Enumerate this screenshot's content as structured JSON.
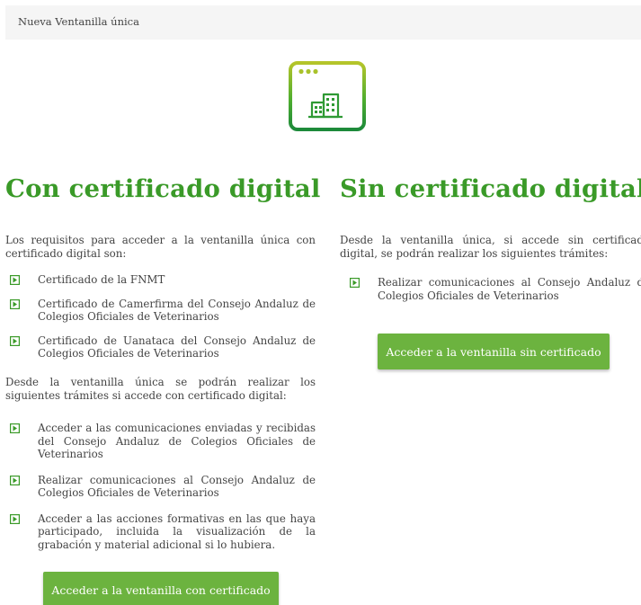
{
  "breadcrumb": {
    "current": "Nueva Ventanilla única"
  },
  "hero": {
    "icon": "browser-window-building-icon",
    "accent_color": "#3a9a28"
  },
  "with_cert": {
    "title": "Con certificado digital",
    "intro": "Los requisitos para acceder a la ventanilla única con certificado digital son:",
    "requirements": [
      "Certificado de la FNMT",
      "Certificado de Camerfirma del Consejo Andaluz de Colegios Oficiales de Veterinarios",
      "Certificado de Uanataca del Consejo Andaluz de Colegios Oficiales de Veterinarios"
    ],
    "procedures_intro": "Desde la ventanilla única se podrán realizar los siguientes trámites si accede con certificado digital:",
    "procedures": [
      "Acceder a las comunicaciones enviadas y recibidas del Consejo Andaluz de Colegios Oficiales de Veterinarios",
      "Realizar comunicaciones al Consejo Andaluz de Colegios Oficiales de Veterinarios",
      "Acceder a las acciones formativas en las que haya participado, incluida la visualización de la grabación y material adicional si lo hubiera."
    ],
    "button_label": "Acceder a la ventanilla con certificado"
  },
  "without_cert": {
    "title": "Sin certificado digital",
    "intro": "Desde la ventanilla única, si accede sin certificado digital, se podrán realizar los siguientes trámites:",
    "procedures": [
      "Realizar comunicaciones al Consejo Andaluz de Colegios Oficiales de Veterinarios"
    ],
    "button_label": "Acceder a la ventanilla sin certificado"
  },
  "colors": {
    "heading_green": "#3a9a28",
    "button_green": "#6cb33f",
    "bullet_green": "#3a9a28"
  }
}
